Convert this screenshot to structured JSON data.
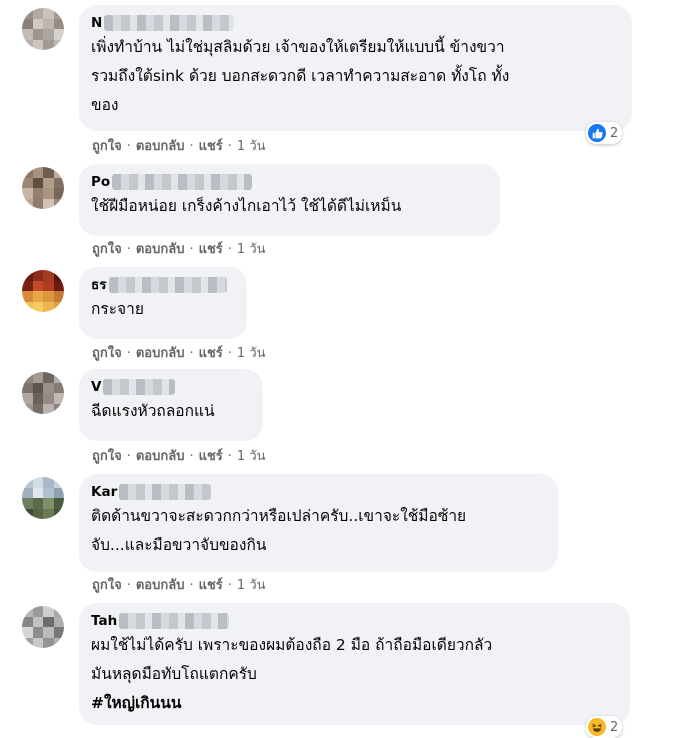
{
  "actions": {
    "like": "ถูกใจ",
    "reply": "ตอบกลับ",
    "share": "แชร์",
    "time": "1 วัน",
    "dot": "·"
  },
  "comments": [
    {
      "name": "N",
      "lines": [
        "เพิ่งทำบ้าน ไม่ใช่มุสลิมด้วย เจ้าของให้เตรียมให้แบบนี้ ข้างขวา",
        "รวมถึงใต้sink ด้วย บอกสะดวกดี เวลาทำความสะอาด ทั้งโถ ทั้ง",
        "ของ"
      ],
      "reaction": {
        "icon": "like-icon",
        "count": "2"
      }
    },
    {
      "name": "Po",
      "lines": [
        "ใช้ฝีมือหน่อย เกร็งค้างไกเอาไว้ ใช้ได้ดีไม่เหม็น"
      ]
    },
    {
      "name": "ธร",
      "lines": [
        "กระจาย"
      ]
    },
    {
      "name": "V",
      "lines": [
        "ฉีดแรงหัวถลอกแน่"
      ]
    },
    {
      "name": "Kar",
      "lines": [
        "ติดด้านขวาจะสะดวกกว่าหรือเปล่าครับ..เขาจะใช้มือซ้าย",
        "จับ...และมือขวาจับของกิน"
      ]
    },
    {
      "name": "Tah",
      "lines": [
        "ผมใช้ไม่ได้ครับ เพราะของผมต้องถือ 2 มือ ถ้าถือมือเดียวกลัว",
        "มันหลุดมือทับโถแตกครับ"
      ],
      "hashtag": "#ใหญ่เกินนน",
      "reaction": {
        "icon": "haha-icon",
        "count": "2"
      }
    }
  ],
  "colors": {
    "bubble": "#f0f2f5",
    "meta": "#65676b",
    "like_blue": "#1877f2",
    "haha_yellow": "#f7b928"
  }
}
